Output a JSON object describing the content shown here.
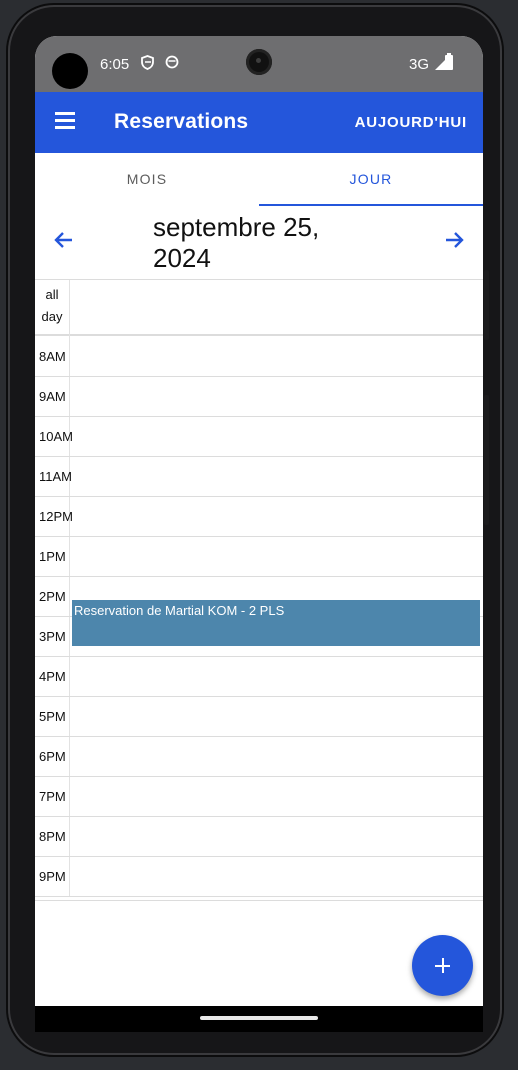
{
  "status_bar": {
    "time": "6:05",
    "network": "3G"
  },
  "app_bar": {
    "title": "Reservations",
    "today_label": "AUJOURD'HUI"
  },
  "tabs": [
    {
      "label": "MOIS",
      "selected": false
    },
    {
      "label": "JOUR",
      "selected": true
    }
  ],
  "date_header": {
    "title": "septembre 25,\n2024"
  },
  "calendar": {
    "all_day_label": "all\nday",
    "hours": [
      "8AM",
      "9AM",
      "10AM",
      "11AM",
      "12PM",
      "1PM",
      "2PM",
      "3PM",
      "4PM",
      "5PM",
      "6PM",
      "7PM",
      "8PM",
      "9PM"
    ],
    "events": [
      {
        "title": "Reservation de Martial KOM - 2 PLS",
        "color": "#4d86ac"
      }
    ]
  },
  "colors": {
    "primary": "#2456db",
    "event": "#4d86ac"
  },
  "icons": {
    "menu": "menu-icon",
    "prev": "arrow-left-icon",
    "next": "arrow-right-icon",
    "add": "plus-icon"
  }
}
